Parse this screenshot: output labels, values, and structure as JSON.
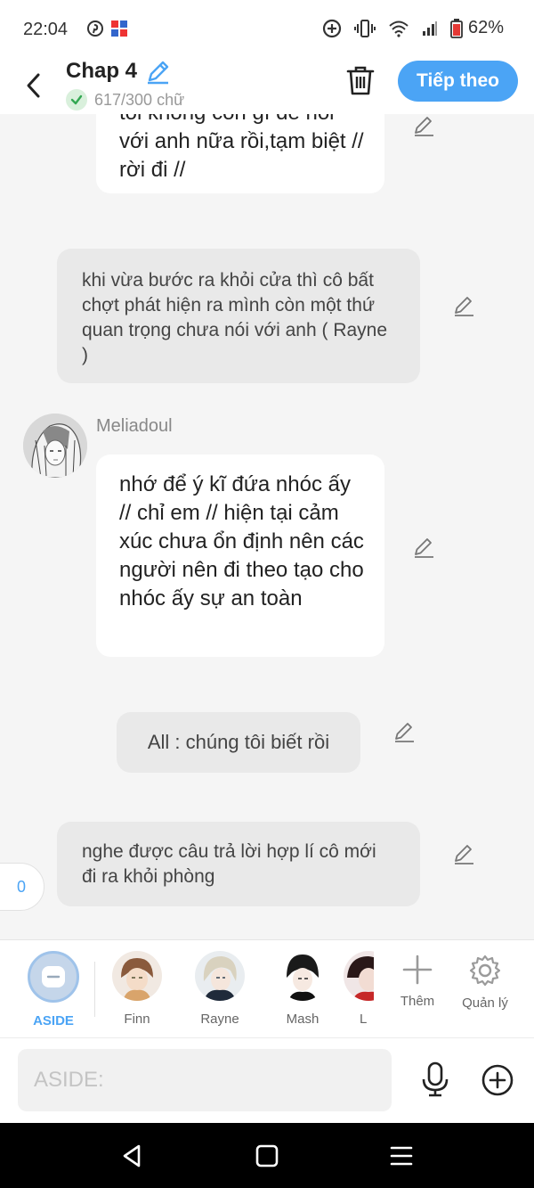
{
  "status_bar": {
    "time": "22:04",
    "battery": "62%"
  },
  "header": {
    "title": "Chap 4",
    "word_count": "617/300 chữ",
    "next_label": "Tiếp theo"
  },
  "messages": [
    {
      "style": "white",
      "text": "tôi không còn gì để nói với anh nữa rồi,tạm biệt // rời đi //"
    },
    {
      "style": "gray",
      "text": "khi vừa bước ra khỏi cửa thì cô bất chợt phát hiện ra mình còn một thứ quan trọng chưa nói với anh ( Rayne )"
    },
    {
      "style": "white",
      "speaker": "Meliadoul",
      "text": "nhớ để ý kĩ đứa nhóc ấy // chỉ em // hiện tại cảm xúc chưa ổn định nên các người nên đi theo tạo cho nhóc ấy sự an toàn"
    },
    {
      "style": "gray-short",
      "text": "All : chúng tôi biết rồi"
    },
    {
      "style": "gray",
      "text": "nghe được câu trả lời hợp lí cô mới đi ra khỏi phòng"
    }
  ],
  "badge_count": "0",
  "characters": [
    {
      "label": "ASIDE",
      "active": true
    },
    {
      "label": "Finn"
    },
    {
      "label": "Rayne"
    },
    {
      "label": "Mash"
    },
    {
      "label": "L"
    }
  ],
  "tools": {
    "add_label": "Thêm",
    "manage_label": "Quản lý"
  },
  "input": {
    "placeholder": "ASIDE:"
  },
  "colors": {
    "accent": "#4ba4f5",
    "bubble_white": "#ffffff",
    "bubble_gray": "#e9e9e9",
    "background": "#f5f5f5"
  }
}
